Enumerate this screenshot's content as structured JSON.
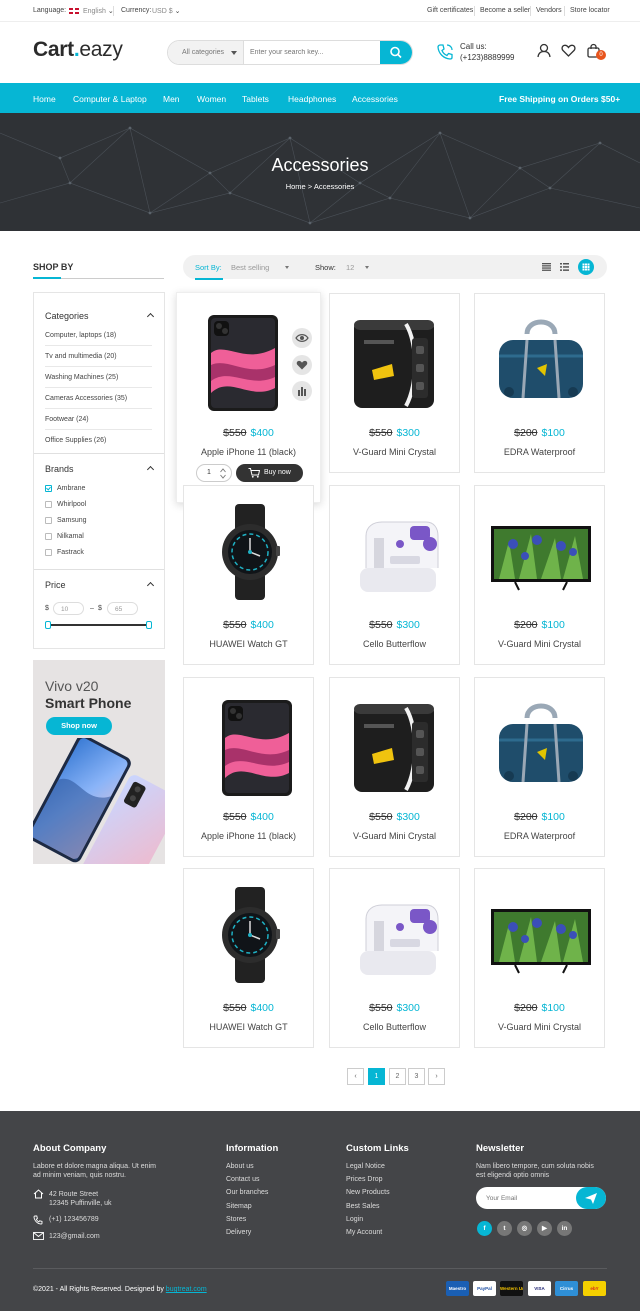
{
  "topbar": {
    "language_label": "Language:",
    "language_value": "English",
    "currency_label": "Currency:",
    "currency_value": "USD $",
    "links": [
      "Gift certificates",
      "Become a seller",
      "Vendors",
      "Store locator"
    ]
  },
  "header": {
    "logo_main": "Cart",
    "logo_dot": ".",
    "logo_rest": "eazy",
    "search_category": "All categories",
    "search_placeholder": "Enter your search key...",
    "call_label": "Call us:",
    "call_number": "(+123)8889999",
    "cart_count": "0"
  },
  "nav": {
    "items": [
      "Home",
      "Computer & Laptop",
      "Men",
      "Women",
      "Tablets",
      "Headphones",
      "Accessories"
    ],
    "shipping": "Free Shipping on Orders $50+"
  },
  "banner": {
    "title": "Accessories",
    "crumb_home": "Home",
    "crumb_sep": ">",
    "crumb_current": "Accessories"
  },
  "sidebar": {
    "shop_by": "SHOP BY",
    "categories_title": "Categories",
    "categories": [
      "Computer, laptops (18)",
      "Tv and multimedia (20)",
      "Washing Machines (25)",
      "Cameras Accessories (35)",
      "Footwear (24)",
      "Office Supplies (26)"
    ],
    "brands_title": "Brands",
    "brands": [
      {
        "label": "Ambrane",
        "checked": true
      },
      {
        "label": "Whirlpool",
        "checked": false
      },
      {
        "label": "Samsung",
        "checked": false
      },
      {
        "label": "Nilkamal",
        "checked": false
      },
      {
        "label": "Fastrack",
        "checked": false
      }
    ],
    "price_title": "Price",
    "currency": "$",
    "price_min": "10",
    "price_max": "65",
    "price_sep": "–"
  },
  "promo": {
    "line1": "Vivo v20",
    "line2": "Smart Phone",
    "button": "Shop now"
  },
  "toolbar": {
    "sort_label": "Sort By:",
    "sort_value": "Best selling",
    "show_label": "Show:",
    "show_value": "12"
  },
  "products": [
    {
      "name": "Apple iPhone 11 (black)",
      "old_price": "$550",
      "new_price": "$400",
      "type": "phone"
    },
    {
      "name": "V-Guard Mini Crystal",
      "old_price": "$550",
      "new_price": "$300",
      "type": "stabilizer"
    },
    {
      "name": "EDRA Waterproof",
      "old_price": "$200",
      "new_price": "$100",
      "type": "bag"
    },
    {
      "name": "HUAWEI Watch GT",
      "old_price": "$550",
      "new_price": "$400",
      "type": "watch"
    },
    {
      "name": "Cello Butterflow",
      "old_price": "$550",
      "new_price": "$300",
      "type": "sewing"
    },
    {
      "name": "V-Guard Mini Crystal",
      "old_price": "$200",
      "new_price": "$100",
      "type": "tv"
    },
    {
      "name": "Apple iPhone 11 (black)",
      "old_price": "$550",
      "new_price": "$400",
      "type": "phone"
    },
    {
      "name": "V-Guard Mini Crystal",
      "old_price": "$550",
      "new_price": "$300",
      "type": "stabilizer"
    },
    {
      "name": "EDRA Waterproof",
      "old_price": "$200",
      "new_price": "$100",
      "type": "bag"
    },
    {
      "name": "HUAWEI Watch GT",
      "old_price": "$550",
      "new_price": "$400",
      "type": "watch"
    },
    {
      "name": "Cello Butterflow",
      "old_price": "$550",
      "new_price": "$300",
      "type": "sewing"
    },
    {
      "name": "V-Guard Mini Crystal",
      "old_price": "$200",
      "new_price": "$100",
      "type": "tv"
    }
  ],
  "product_actions": {
    "quantity": "1",
    "buy_now": "Buy now"
  },
  "pagination": {
    "prev": "‹",
    "pages": [
      "1",
      "2",
      "3"
    ],
    "next": "›",
    "current": "1"
  },
  "footer": {
    "about_title": "About Company",
    "about_text_1": "Labore et dolore magna aliqua. Ut enim",
    "about_text_2": "ad minim veniam, quis nostru.",
    "address_1": "42 Route Street",
    "address_2": "12345 Puffinville, uk",
    "phone": "(+1) 123456789",
    "email": "123@gmail.com",
    "info_title": "Information",
    "info_links": [
      "About us",
      "Contact us",
      "Our branches",
      "Sitemap",
      "Stores",
      "Delivery"
    ],
    "custom_title": "Custom Links",
    "custom_links": [
      "Legal Notice",
      "Prices Drop",
      "New Products",
      "Best Sales",
      "Login",
      "My Account"
    ],
    "newsletter_title": "Newsletter",
    "newsletter_text_1": "Nam libero tempore, cum soluta nobis",
    "newsletter_text_2": "est eligendi optio omnis",
    "newsletter_placeholder": "Your Email",
    "social": [
      "f",
      "t",
      "◎",
      "▶",
      "in"
    ],
    "copyright": "©2021 - All Rights Reserved. Designed by",
    "designer": "bugtreat.com",
    "payments": [
      "Maestro",
      "PayPal",
      "Western Union",
      "VISA",
      "Cirrus",
      "ebY"
    ]
  },
  "colors": {
    "accent": "#06b6d4",
    "dark": "#333333",
    "footer_bg": "#444548",
    "badge": "#e8541c"
  }
}
